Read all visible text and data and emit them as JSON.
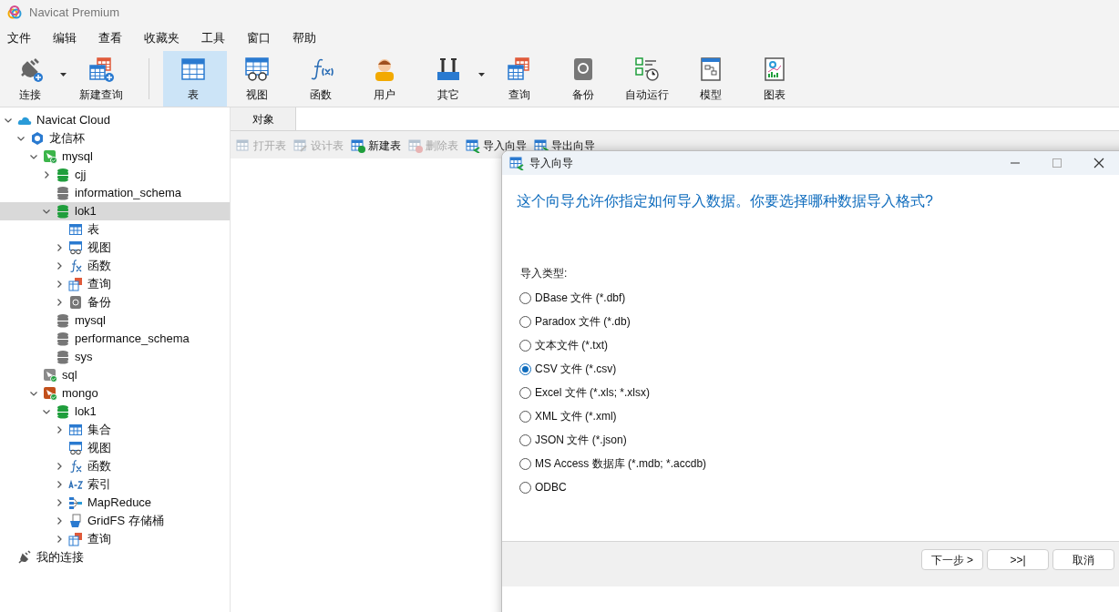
{
  "window": {
    "title": "Navicat Premium"
  },
  "menu": [
    "文件",
    "编辑",
    "查看",
    "收藏夹",
    "工具",
    "窗口",
    "帮助"
  ],
  "toolbar": [
    {
      "kind": "connect",
      "label": "连接",
      "selected": false,
      "dropdown": true
    },
    {
      "kind": "new-query",
      "label": "新建查询",
      "selected": false,
      "dropdown": false
    },
    {
      "kind": "table",
      "label": "表",
      "selected": true,
      "dropdown": false
    },
    {
      "kind": "view",
      "label": "视图",
      "selected": false,
      "dropdown": false
    },
    {
      "kind": "function",
      "label": "函数",
      "selected": false,
      "dropdown": false
    },
    {
      "kind": "user",
      "label": "用户",
      "selected": false,
      "dropdown": false
    },
    {
      "kind": "other",
      "label": "其它",
      "selected": false,
      "dropdown": true
    },
    {
      "kind": "query",
      "label": "查询",
      "selected": false,
      "dropdown": false
    },
    {
      "kind": "backup",
      "label": "备份",
      "selected": false,
      "dropdown": false
    },
    {
      "kind": "automation",
      "label": "自动运行",
      "selected": false,
      "dropdown": false
    },
    {
      "kind": "model",
      "label": "模型",
      "selected": false,
      "dropdown": false
    },
    {
      "kind": "chart",
      "label": "图表",
      "selected": false,
      "dropdown": false
    }
  ],
  "tree": [
    {
      "kind": "cloud",
      "label": "Navicat Cloud",
      "selected": false,
      "expanded": true,
      "children": [
        {
          "kind": "project",
          "label": "龙信杯",
          "selected": false,
          "expanded": true,
          "children": [
            {
              "kind": "mysql",
              "label": "mysql",
              "selected": false,
              "expanded": true,
              "children": [
                {
                  "kind": "database",
                  "label": "cjj",
                  "selected": false,
                  "expanded": false
                },
                {
                  "kind": "database-off",
                  "label": "information_schema",
                  "selected": false
                },
                {
                  "kind": "database",
                  "label": "lok1",
                  "selected": true,
                  "expanded": true,
                  "children": [
                    {
                      "kind": "table",
                      "label": "表",
                      "selected": false
                    },
                    {
                      "kind": "view",
                      "label": "视图",
                      "selected": false,
                      "expanded": false
                    },
                    {
                      "kind": "function",
                      "label": "函数",
                      "selected": false,
                      "expanded": false
                    },
                    {
                      "kind": "query",
                      "label": "查询",
                      "selected": false,
                      "expanded": false
                    },
                    {
                      "kind": "backup",
                      "label": "备份",
                      "selected": false,
                      "expanded": false
                    }
                  ]
                },
                {
                  "kind": "database-off",
                  "label": "mysql",
                  "selected": false
                },
                {
                  "kind": "database-off",
                  "label": "performance_schema",
                  "selected": false
                },
                {
                  "kind": "database-off",
                  "label": "sys",
                  "selected": false
                }
              ]
            },
            {
              "kind": "sql",
              "label": "sql",
              "selected": false
            },
            {
              "kind": "mongo",
              "label": "mongo",
              "selected": false,
              "expanded": true,
              "children": [
                {
                  "kind": "database",
                  "label": "lok1",
                  "selected": false,
                  "expanded": true,
                  "children": [
                    {
                      "kind": "table",
                      "label": "集合",
                      "selected": false,
                      "expanded": false
                    },
                    {
                      "kind": "view",
                      "label": "视图",
                      "selected": false
                    },
                    {
                      "kind": "function",
                      "label": "函数",
                      "selected": false,
                      "expanded": false
                    },
                    {
                      "kind": "index",
                      "label": "索引",
                      "selected": false,
                      "expanded": false
                    },
                    {
                      "kind": "mapreduce",
                      "label": "MapReduce",
                      "selected": false,
                      "expanded": false
                    },
                    {
                      "kind": "gridfs",
                      "label": "GridFS 存储桶",
                      "selected": false,
                      "expanded": false
                    },
                    {
                      "kind": "query",
                      "label": "查询",
                      "selected": false,
                      "expanded": false
                    }
                  ]
                }
              ]
            }
          ]
        }
      ]
    },
    {
      "kind": "connection",
      "label": "我的连接",
      "selected": false
    }
  ],
  "tabs": [
    {
      "label": "对象",
      "selected": true
    }
  ],
  "object_toolbar": [
    {
      "kind": "open",
      "label": "打开表",
      "disabled": true
    },
    {
      "kind": "design",
      "label": "设计表",
      "disabled": true
    },
    {
      "kind": "new",
      "label": "新建表",
      "disabled": false
    },
    {
      "kind": "delete",
      "label": "删除表",
      "disabled": true
    },
    {
      "kind": "import",
      "label": "导入向导",
      "disabled": false
    },
    {
      "kind": "export",
      "label": "导出向导",
      "disabled": false
    }
  ],
  "dialog": {
    "title": "导入向导",
    "heading": "这个向导允许你指定如何导入数据。你要选择哪种数据导入格式?",
    "group_label": "导入类型:",
    "options": [
      {
        "label": "DBase 文件 (*.dbf)",
        "selected": false
      },
      {
        "label": "Paradox 文件 (*.db)",
        "selected": false
      },
      {
        "label": "文本文件 (*.txt)",
        "selected": false
      },
      {
        "label": "CSV 文件 (*.csv)",
        "selected": true
      },
      {
        "label": "Excel 文件 (*.xls; *.xlsx)",
        "selected": false
      },
      {
        "label": "XML 文件 (*.xml)",
        "selected": false
      },
      {
        "label": "JSON 文件 (*.json)",
        "selected": false
      },
      {
        "label": "MS Access 数据库 (*.mdb; *.accdb)",
        "selected": false
      },
      {
        "label": "ODBC",
        "selected": false
      }
    ],
    "buttons": [
      "下一步 >",
      ">>|",
      "取消"
    ]
  }
}
